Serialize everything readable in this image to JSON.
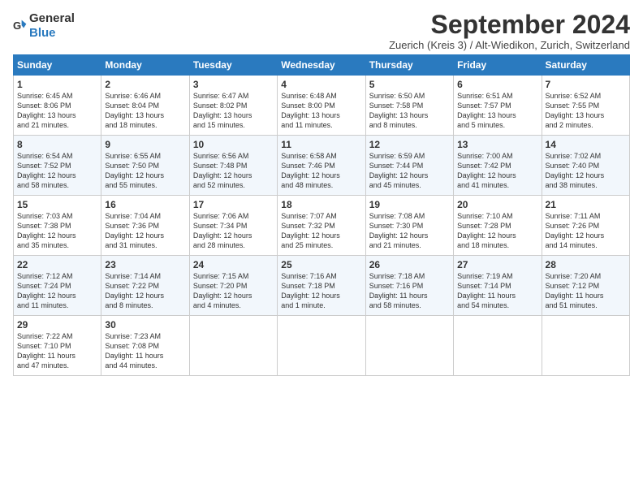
{
  "header": {
    "logo_general": "General",
    "logo_blue": "Blue",
    "title": "September 2024",
    "subtitle": "Zuerich (Kreis 3) / Alt-Wiedikon, Zurich, Switzerland"
  },
  "days_of_week": [
    "Sunday",
    "Monday",
    "Tuesday",
    "Wednesday",
    "Thursday",
    "Friday",
    "Saturday"
  ],
  "weeks": [
    [
      {
        "day": 1,
        "info": "Sunrise: 6:45 AM\nSunset: 8:06 PM\nDaylight: 13 hours\nand 21 minutes."
      },
      {
        "day": 2,
        "info": "Sunrise: 6:46 AM\nSunset: 8:04 PM\nDaylight: 13 hours\nand 18 minutes."
      },
      {
        "day": 3,
        "info": "Sunrise: 6:47 AM\nSunset: 8:02 PM\nDaylight: 13 hours\nand 15 minutes."
      },
      {
        "day": 4,
        "info": "Sunrise: 6:48 AM\nSunset: 8:00 PM\nDaylight: 13 hours\nand 11 minutes."
      },
      {
        "day": 5,
        "info": "Sunrise: 6:50 AM\nSunset: 7:58 PM\nDaylight: 13 hours\nand 8 minutes."
      },
      {
        "day": 6,
        "info": "Sunrise: 6:51 AM\nSunset: 7:57 PM\nDaylight: 13 hours\nand 5 minutes."
      },
      {
        "day": 7,
        "info": "Sunrise: 6:52 AM\nSunset: 7:55 PM\nDaylight: 13 hours\nand 2 minutes."
      }
    ],
    [
      {
        "day": 8,
        "info": "Sunrise: 6:54 AM\nSunset: 7:52 PM\nDaylight: 12 hours\nand 58 minutes."
      },
      {
        "day": 9,
        "info": "Sunrise: 6:55 AM\nSunset: 7:50 PM\nDaylight: 12 hours\nand 55 minutes."
      },
      {
        "day": 10,
        "info": "Sunrise: 6:56 AM\nSunset: 7:48 PM\nDaylight: 12 hours\nand 52 minutes."
      },
      {
        "day": 11,
        "info": "Sunrise: 6:58 AM\nSunset: 7:46 PM\nDaylight: 12 hours\nand 48 minutes."
      },
      {
        "day": 12,
        "info": "Sunrise: 6:59 AM\nSunset: 7:44 PM\nDaylight: 12 hours\nand 45 minutes."
      },
      {
        "day": 13,
        "info": "Sunrise: 7:00 AM\nSunset: 7:42 PM\nDaylight: 12 hours\nand 41 minutes."
      },
      {
        "day": 14,
        "info": "Sunrise: 7:02 AM\nSunset: 7:40 PM\nDaylight: 12 hours\nand 38 minutes."
      }
    ],
    [
      {
        "day": 15,
        "info": "Sunrise: 7:03 AM\nSunset: 7:38 PM\nDaylight: 12 hours\nand 35 minutes."
      },
      {
        "day": 16,
        "info": "Sunrise: 7:04 AM\nSunset: 7:36 PM\nDaylight: 12 hours\nand 31 minutes."
      },
      {
        "day": 17,
        "info": "Sunrise: 7:06 AM\nSunset: 7:34 PM\nDaylight: 12 hours\nand 28 minutes."
      },
      {
        "day": 18,
        "info": "Sunrise: 7:07 AM\nSunset: 7:32 PM\nDaylight: 12 hours\nand 25 minutes."
      },
      {
        "day": 19,
        "info": "Sunrise: 7:08 AM\nSunset: 7:30 PM\nDaylight: 12 hours\nand 21 minutes."
      },
      {
        "day": 20,
        "info": "Sunrise: 7:10 AM\nSunset: 7:28 PM\nDaylight: 12 hours\nand 18 minutes."
      },
      {
        "day": 21,
        "info": "Sunrise: 7:11 AM\nSunset: 7:26 PM\nDaylight: 12 hours\nand 14 minutes."
      }
    ],
    [
      {
        "day": 22,
        "info": "Sunrise: 7:12 AM\nSunset: 7:24 PM\nDaylight: 12 hours\nand 11 minutes."
      },
      {
        "day": 23,
        "info": "Sunrise: 7:14 AM\nSunset: 7:22 PM\nDaylight: 12 hours\nand 8 minutes."
      },
      {
        "day": 24,
        "info": "Sunrise: 7:15 AM\nSunset: 7:20 PM\nDaylight: 12 hours\nand 4 minutes."
      },
      {
        "day": 25,
        "info": "Sunrise: 7:16 AM\nSunset: 7:18 PM\nDaylight: 12 hours\nand 1 minute."
      },
      {
        "day": 26,
        "info": "Sunrise: 7:18 AM\nSunset: 7:16 PM\nDaylight: 11 hours\nand 58 minutes."
      },
      {
        "day": 27,
        "info": "Sunrise: 7:19 AM\nSunset: 7:14 PM\nDaylight: 11 hours\nand 54 minutes."
      },
      {
        "day": 28,
        "info": "Sunrise: 7:20 AM\nSunset: 7:12 PM\nDaylight: 11 hours\nand 51 minutes."
      }
    ],
    [
      {
        "day": 29,
        "info": "Sunrise: 7:22 AM\nSunset: 7:10 PM\nDaylight: 11 hours\nand 47 minutes."
      },
      {
        "day": 30,
        "info": "Sunrise: 7:23 AM\nSunset: 7:08 PM\nDaylight: 11 hours\nand 44 minutes."
      },
      null,
      null,
      null,
      null,
      null
    ]
  ]
}
